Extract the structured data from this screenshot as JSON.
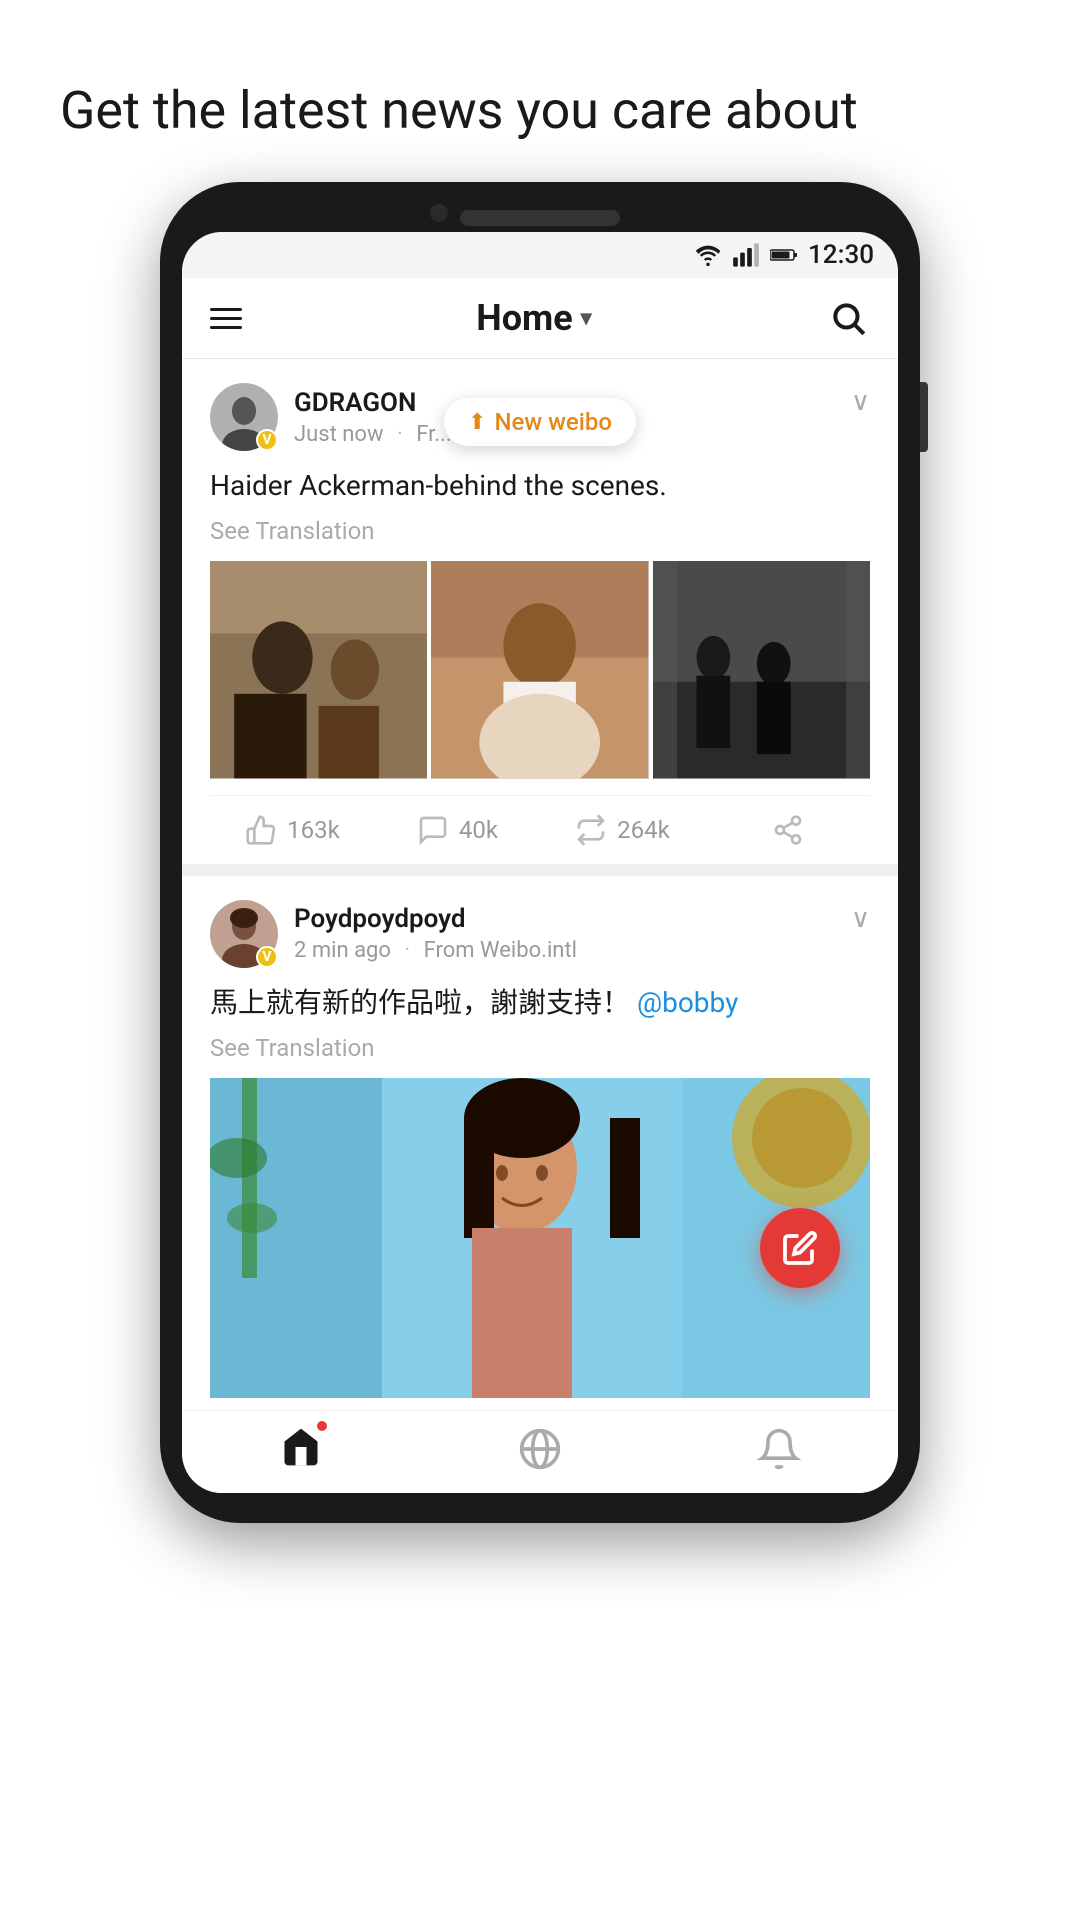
{
  "page": {
    "headline": "Get the latest news you care about"
  },
  "status_bar": {
    "time": "12:30"
  },
  "header": {
    "title": "Home",
    "menu_label": "Menu",
    "search_label": "Search"
  },
  "new_weibo": {
    "label": "New weibo"
  },
  "posts": [
    {
      "username": "GDRAGON",
      "time": "Just now",
      "source": "Fr...",
      "text": "Haider Ackerman-behind the scenes.",
      "see_translation": "See Translation",
      "likes": "163k",
      "comments": "40k",
      "reposts": "264k",
      "has_images": true
    },
    {
      "username": "Poydpoydpoyd",
      "time": "2 min ago",
      "source": "From Weibo.intl",
      "text": "馬上就有新的作品啦，謝謝支持！",
      "mention": "@bobby",
      "see_translation": "See Translation",
      "has_single_image": true
    }
  ],
  "bottom_nav": {
    "home_label": "Home",
    "explore_label": "Explore",
    "notifications_label": "Notifications"
  },
  "fab": {
    "label": "Compose"
  }
}
